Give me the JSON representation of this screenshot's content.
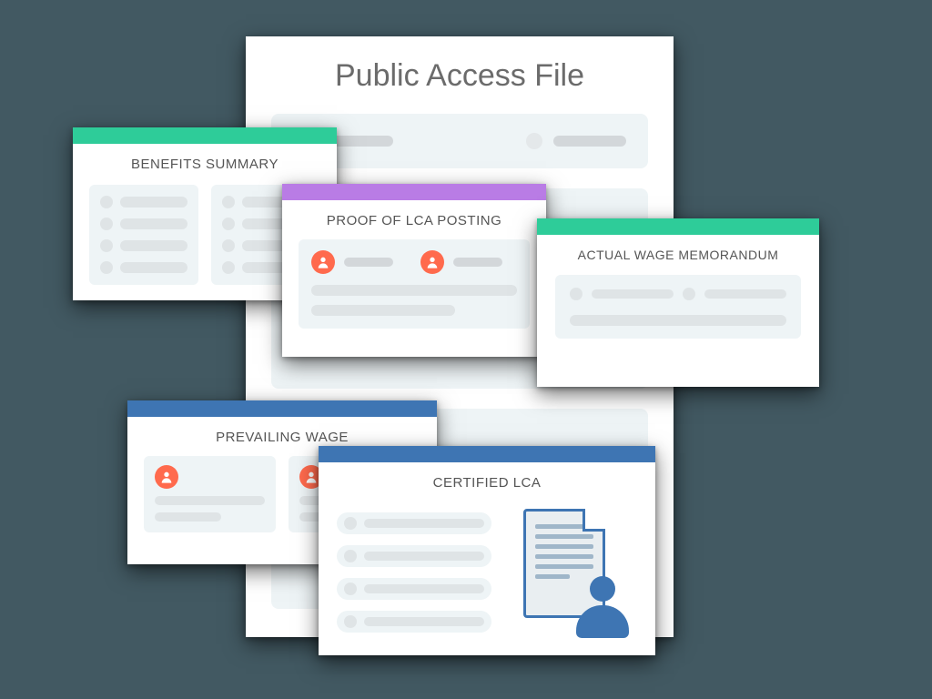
{
  "colors": {
    "background": "#425962",
    "green": "#2ecc99",
    "purple": "#b97ce5",
    "blue": "#3e75b3",
    "panel": "#eef4f6",
    "placeholder": "#d3d7da"
  },
  "main": {
    "title": "Public Access File"
  },
  "cards": {
    "benefits": {
      "title": "BENEFITS SUMMARY",
      "accent": "green"
    },
    "proof": {
      "title": "PROOF OF LCA POSTING",
      "accent": "purple"
    },
    "awm": {
      "title": "ACTUAL WAGE MEMORANDUM",
      "accent": "green"
    },
    "prev": {
      "title": "PREVAILING WAGE",
      "accent": "blue"
    },
    "cert": {
      "title": "CERTIFIED LCA",
      "accent": "blue"
    }
  },
  "icons": {
    "avatar": "person-avatar-icon",
    "document_person": "document-person-icon"
  }
}
